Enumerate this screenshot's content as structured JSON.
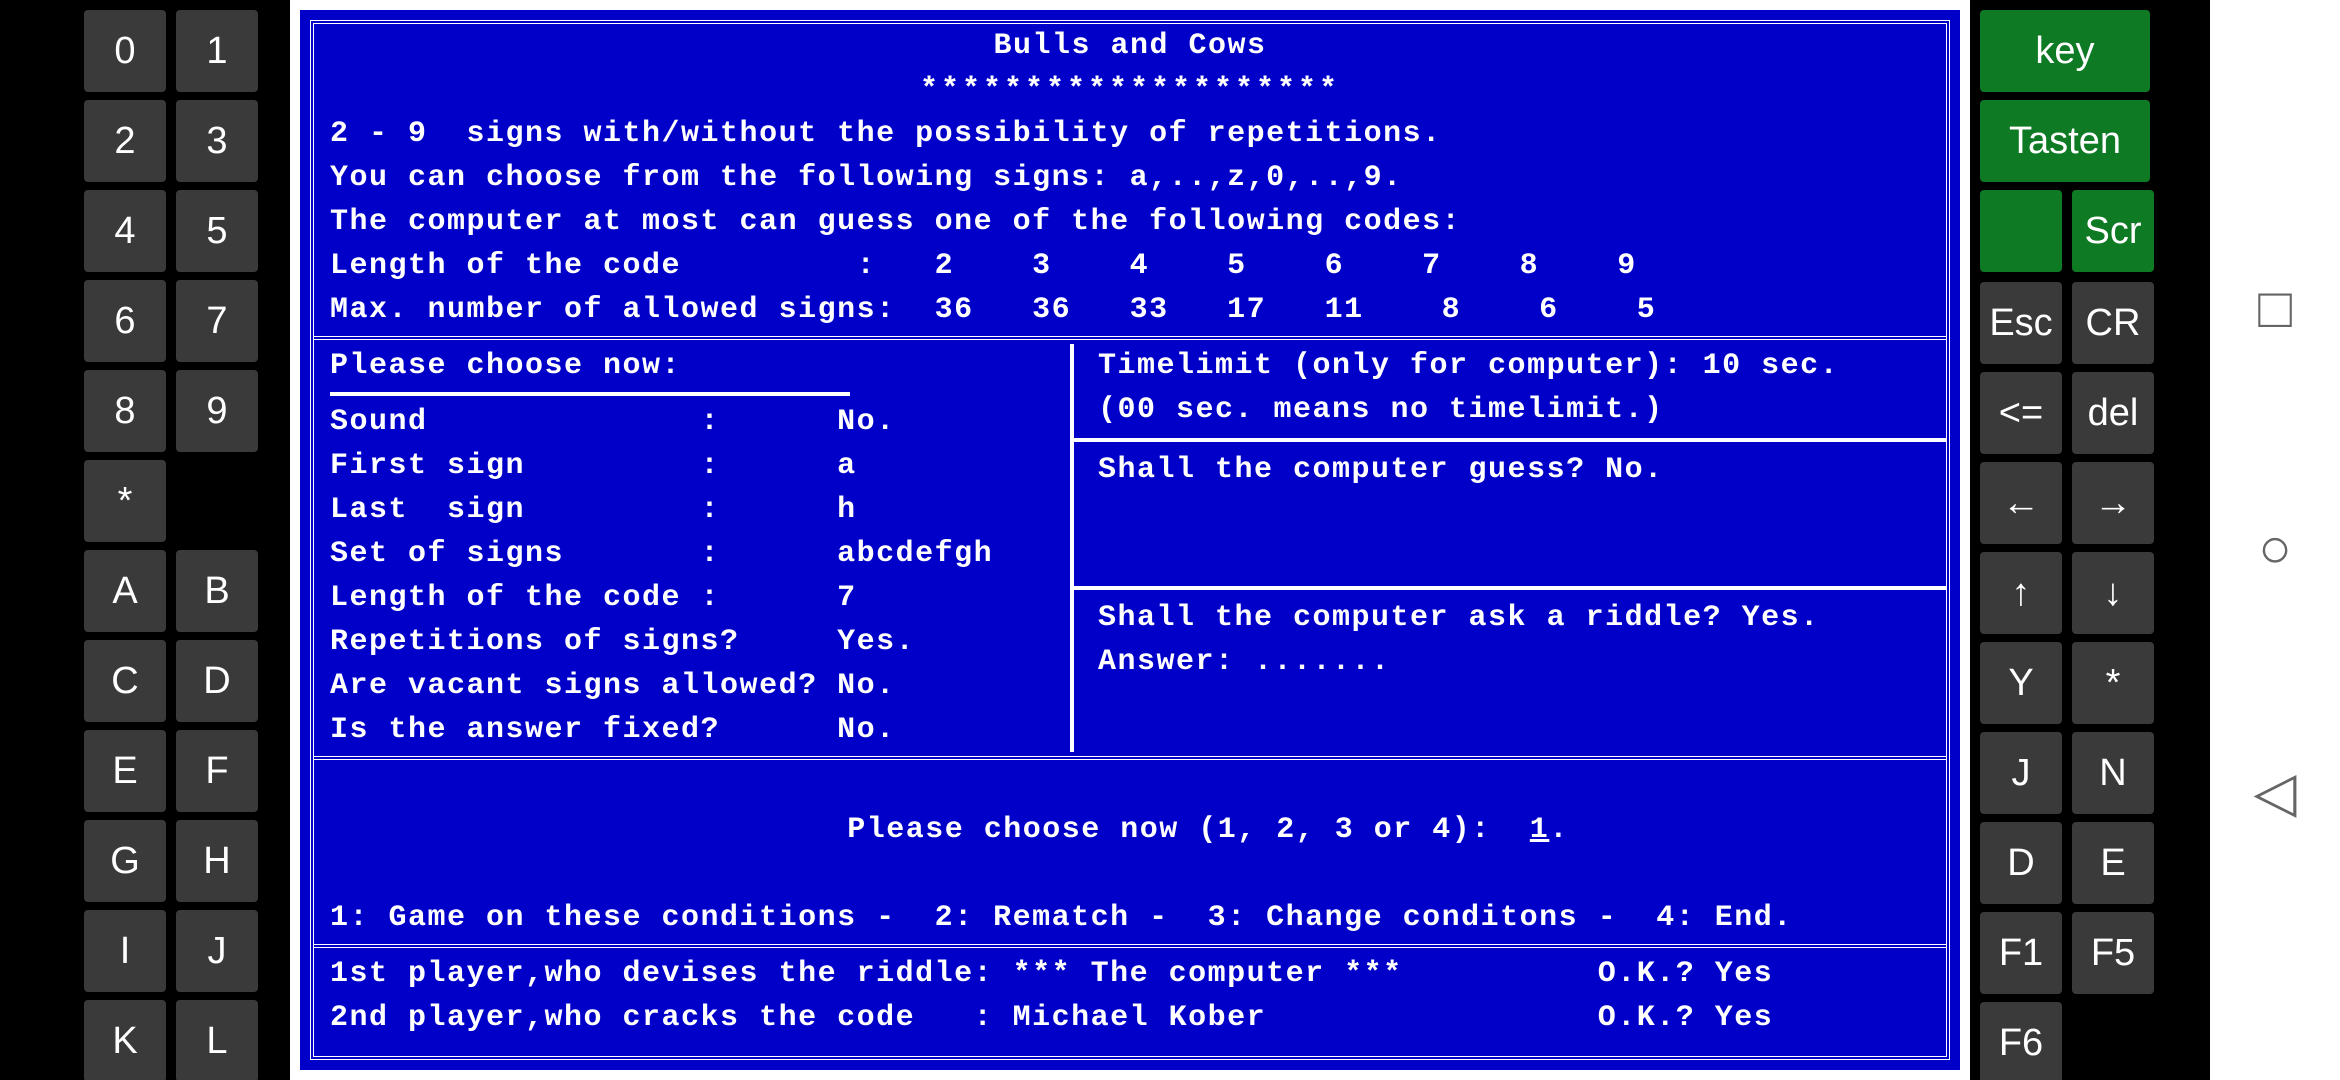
{
  "keypad_left": [
    [
      "0",
      "1"
    ],
    [
      "2",
      "3"
    ],
    [
      "4",
      "5"
    ],
    [
      "6",
      "7"
    ],
    [
      "8",
      "9"
    ],
    [
      "*",
      ""
    ],
    [
      "A",
      "B"
    ],
    [
      "C",
      "D"
    ],
    [
      "E",
      "F"
    ],
    [
      "G",
      "H"
    ],
    [
      "I",
      "J"
    ],
    [
      "K",
      "L"
    ]
  ],
  "keypad_right": {
    "green": [
      "key",
      "Tasten",
      "",
      "Scr"
    ],
    "rows": [
      [
        "Esc",
        "CR"
      ],
      [
        "<=",
        "del"
      ],
      [
        "←",
        "→"
      ],
      [
        "↑",
        "↓"
      ],
      [
        "Y",
        "*"
      ],
      [
        "J",
        "N"
      ],
      [
        "D",
        "E"
      ],
      [
        "F1",
        "F5"
      ],
      [
        "F6",
        ""
      ]
    ]
  },
  "nav_icons": [
    "□",
    "○",
    "◁"
  ],
  "title": "Bulls and Cows",
  "title_stars": "********************",
  "intro": [
    "2 - 9  signs with/without the possibility of repetitions.",
    "You can choose from the following signs: a,..,z,0,..,9.",
    "The computer at most can guess one of the following codes:",
    "Length of the code         :   2    3    4    5    6    7    8    9",
    "Max. number of allowed signs:  36   36   33   17   11    8    6    5"
  ],
  "left_panel": {
    "heading": "Please choose now:",
    "items": [
      "Sound              :      No.",
      "First sign         :      a",
      "Last  sign         :      h",
      "Set of signs       :      abcdefgh",
      "Length of the code :      7",
      "Repetitions of signs?     Yes.",
      "Are vacant signs allowed? No.",
      "Is the answer fixed?      No."
    ]
  },
  "right_panel": {
    "timelimit1": "Timelimit (only for computer): 10 sec.",
    "timelimit2": "(00 sec. means no timelimit.)",
    "guess": "Shall the computer guess? No.",
    "riddle": "Shall the computer ask a riddle? Yes.",
    "answer": "Answer: ......."
  },
  "menu": {
    "prompt_pre": "Please choose now (1, 2, 3 or 4):  ",
    "prompt_val": "1",
    "prompt_post": ".",
    "options": "1: Game on these conditions -  2: Rematch -  3: Change conditons -  4: End."
  },
  "players": {
    "p1": "1st player,who devises the riddle: *** The computer ***          O.K.? Yes",
    "p2": "2nd player,who cracks the code   : Michael Kober                 O.K.? Yes"
  }
}
